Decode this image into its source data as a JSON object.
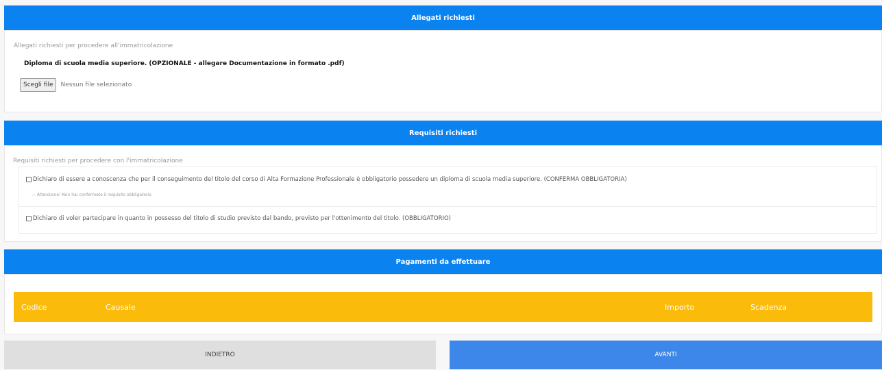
{
  "allegati": {
    "header": "Allegati richiesti",
    "subtitle": "Allegati richiesti per procedere all'immatricolazione",
    "document_label": "Diploma di scuola media superiore. (OPZIONALE - allegare Documentazione in formato .pdf)",
    "file_button_label": "Scegli file",
    "file_status": "Nessun file selezionato"
  },
  "requisiti": {
    "header": "Requisiti richiesti",
    "subtitle": "Requisiti richiesti per procedere con l'immatricolazione",
    "items": [
      {
        "label": "Dichiaro di essere a conoscenza che per il conseguimento del titolo del corso di Alta Formazione Professionale è obbligatorio possedere un diploma di scuola media superiore. (CONFERMA OBBLIGATORIA)",
        "note": "— Attenzione! Non hai confermato il requisito obbligatorio",
        "checked": false
      },
      {
        "label": "Dichiaro di voler partecipare in quanto in possesso del titolo di studio previsto dal bando, previsto per l'ottenimento del titolo. (OBBLIGATORIO)",
        "checked": false
      }
    ]
  },
  "pagamenti": {
    "header": "Pagamenti da effettuare",
    "columns": [
      "Codice",
      "Causale",
      "Importo",
      "Scadenza"
    ]
  },
  "buttons": {
    "back": "INDIETRO",
    "next": "AVANTI"
  },
  "colors": {
    "header_blue": "#0a82f0",
    "table_header_yellow": "#fbbb0a",
    "next_button": "#3d87ea",
    "back_button": "#dfdfdf"
  }
}
